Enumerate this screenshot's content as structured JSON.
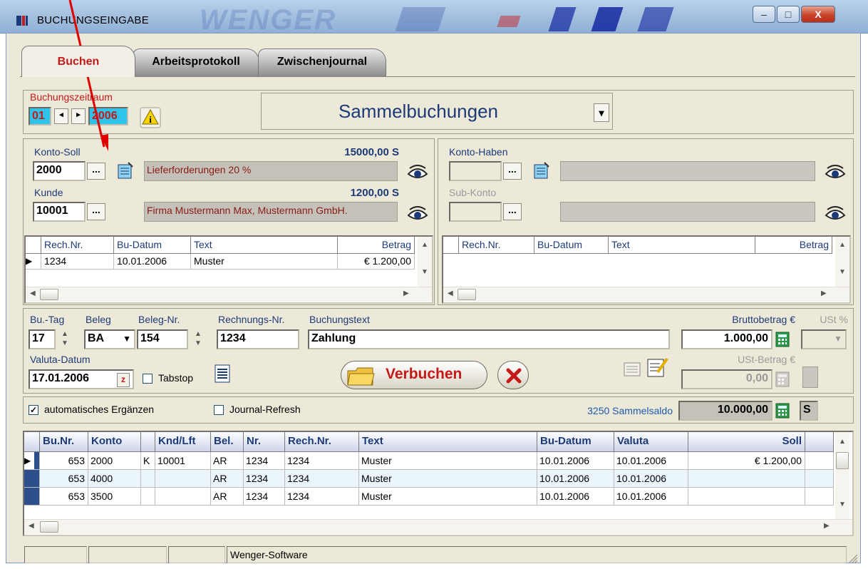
{
  "window": {
    "title": "BUCHUNGSEINGABE",
    "logo_text": "WENGER",
    "buttons": {
      "minimize": "–",
      "maximize": "□",
      "close": "X"
    }
  },
  "tabs": [
    {
      "label": "Buchen",
      "active": true
    },
    {
      "label": "Arbeitsprotokoll",
      "active": false
    },
    {
      "label": "Zwischenjournal",
      "active": false
    }
  ],
  "period": {
    "label": "Buchungszeitraum",
    "month": "01",
    "year": "2006",
    "prev": "◂",
    "next": "▸",
    "info_icon": "info-icon"
  },
  "mode_select": {
    "value": "Sammelbuchungen",
    "arrow": "▾"
  },
  "soll": {
    "konto_label": "Konto-Soll",
    "konto_amount": "15000,00  S",
    "konto_value": "2000",
    "konto_name": "Lieferforderungen 20 %",
    "kunde_label": "Kunde",
    "kunde_amount": "1200,00  S",
    "kunde_value": "10001",
    "kunde_name": "Firma Mustermann Max,  Mustermann GmbH.",
    "dots": "...",
    "grid": {
      "columns": [
        "Rech.Nr.",
        "Bu-Datum",
        "Text",
        "Betrag"
      ],
      "rows": [
        [
          "1234",
          "10.01.2006",
          "Muster",
          "€ 1.200,00"
        ]
      ]
    }
  },
  "haben": {
    "konto_label": "Konto-Haben",
    "subkonto_label": "Sub-Konto",
    "dots": "...",
    "grid": {
      "columns": [
        "Rech.Nr.",
        "Bu-Datum",
        "Text",
        "Betrag"
      ]
    }
  },
  "entry": {
    "butag_label": "Bu.-Tag",
    "butag_value": "17",
    "beleg_label": "Beleg",
    "beleg_value": "BA",
    "belegnr_label": "Beleg-Nr.",
    "belegnr_value": "154",
    "rechnr_label": "Rechnungs-Nr.",
    "rechnr_value": "1234",
    "buchungstext_label": "Buchungstext",
    "buchungstext_value": "Zahlung",
    "brutto_label": "Bruttobetrag  €",
    "brutto_value": "1.000,00",
    "ust_label": "USt %",
    "valuta_label": "Valuta-Datum",
    "valuta_value": "17.01.2006",
    "z_label": "z",
    "tabstop_label": "Tabstop",
    "verbuchen_label": "Verbuchen",
    "ustbetrag_label": "USt-Betrag  €",
    "ustbetrag_value": "0,00"
  },
  "options": {
    "auto_label": "automatisches Ergänzen",
    "auto_checked": true,
    "check_mark": "✓",
    "refresh_label": "Journal-Refresh",
    "refresh_checked": false,
    "saldo_label": "3250  Sammelsaldo",
    "saldo_value": "10.000,00",
    "saldo_side": "S"
  },
  "journal": {
    "columns": [
      "Bu.Nr.",
      "Konto",
      "",
      "Knd/Lft",
      "Bel.",
      "Nr.",
      "Rech.Nr.",
      "Text",
      "Bu-Datum",
      "Valuta",
      "Soll"
    ],
    "rows": [
      [
        "653",
        "2000",
        "K",
        "10001",
        "AR",
        "1234",
        "1234",
        "Muster",
        "10.01.2006",
        "10.01.2006",
        "€ 1.200,00"
      ],
      [
        "653",
        "4000",
        "",
        "",
        "AR",
        "1234",
        "1234",
        "Muster",
        "10.01.2006",
        "10.01.2006",
        ""
      ],
      [
        "653",
        "3500",
        "",
        "",
        "AR",
        "1234",
        "1234",
        "Muster",
        "10.01.2006",
        "10.01.2006",
        ""
      ]
    ]
  },
  "statusbar": {
    "text": "Wenger-Software"
  },
  "colors": {
    "accent_red": "#c51a1a",
    "label_blue": "#1d3a78",
    "annotation_arrow": "#e00000"
  }
}
